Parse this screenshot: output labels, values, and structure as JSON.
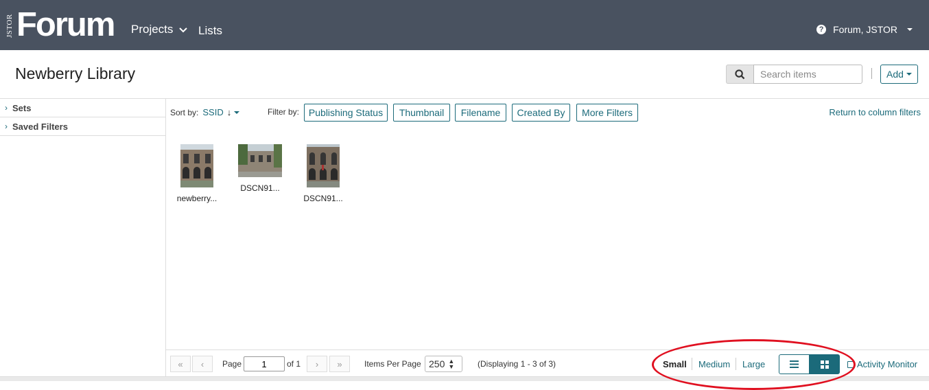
{
  "topbar": {
    "logo_small": "JSTOR",
    "logo_main": "Forum",
    "nav_projects": "Projects",
    "nav_lists": "Lists",
    "user": "Forum, JSTOR"
  },
  "header": {
    "title": "Newberry Library",
    "search_placeholder": "Search items",
    "add_label": "Add"
  },
  "sidebar": {
    "items": [
      {
        "label": "Sets"
      },
      {
        "label": "Saved Filters"
      }
    ]
  },
  "toolbar": {
    "sort_label": "Sort by:",
    "sort_value": "SSID",
    "filter_label": "Filter by:",
    "filters": [
      "Publishing Status",
      "Thumbnail",
      "Filename",
      "Created By",
      "More Filters"
    ],
    "return_link": "Return to column filters"
  },
  "items": [
    {
      "caption": "newberry..."
    },
    {
      "caption": "DSCN91..."
    },
    {
      "caption": "DSCN91..."
    }
  ],
  "pagination": {
    "page_label": "Page",
    "page_value": "1",
    "of_label": "of 1",
    "items_per_page_label": "Items Per Page",
    "items_per_page_value": "250",
    "displaying": "(Displaying 1 - 3 of 3)"
  },
  "view": {
    "sizes": [
      "Small",
      "Medium",
      "Large"
    ],
    "selected_size": "Small",
    "activity_monitor": "Activity Monitor"
  },
  "colors": {
    "topbar": "#495260",
    "accent": "#1b6a7a",
    "annotation": "#e01020"
  }
}
